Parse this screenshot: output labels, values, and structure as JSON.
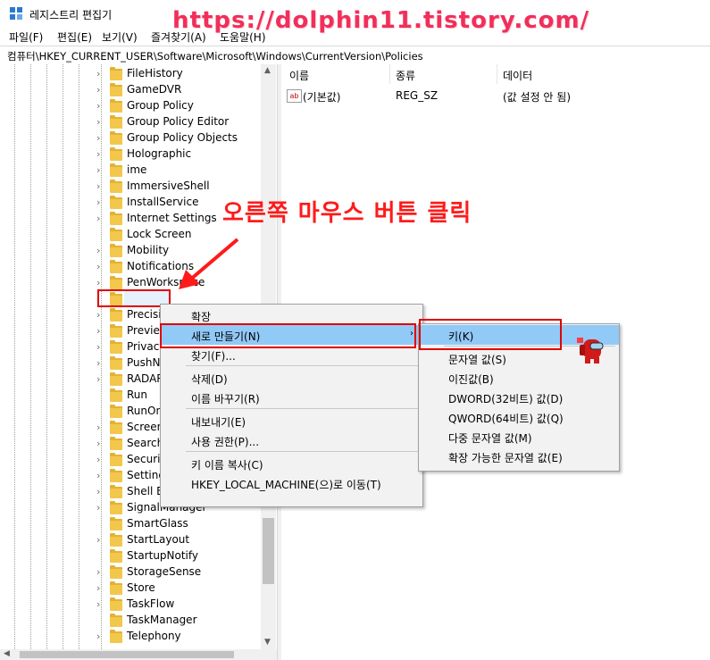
{
  "window": {
    "title": "레지스트리 편집기",
    "watermark": "https://dolphin11.tistory.com/"
  },
  "menubar": {
    "items": [
      "파일(F)",
      "편집(E)",
      "보기(V)",
      "즐겨찾기(A)",
      "도움말(H)"
    ]
  },
  "address": {
    "path": "컴퓨터\\HKEY_CURRENT_USER\\Software\\Microsoft\\Windows\\CurrentVersion\\Policies"
  },
  "tree": {
    "items": [
      {
        "label": "FileHistory",
        "expandable": true
      },
      {
        "label": "GameDVR",
        "expandable": true
      },
      {
        "label": "Group Policy",
        "expandable": true
      },
      {
        "label": "Group Policy Editor",
        "expandable": true
      },
      {
        "label": "Group Policy Objects",
        "expandable": true
      },
      {
        "label": "Holographic",
        "expandable": true
      },
      {
        "label": "ime",
        "expandable": true
      },
      {
        "label": "ImmersiveShell",
        "expandable": true
      },
      {
        "label": "InstallService",
        "expandable": true
      },
      {
        "label": "Internet Settings",
        "expandable": true
      },
      {
        "label": "Lock Screen",
        "expandable": false
      },
      {
        "label": "Mobility",
        "expandable": true
      },
      {
        "label": "Notifications",
        "expandable": true
      },
      {
        "label": "PenWorkspace",
        "expandable": true
      },
      {
        "label": "Policies",
        "expandable": false
      },
      {
        "label": "Precisio",
        "expandable": true
      },
      {
        "label": "Preview",
        "expandable": true
      },
      {
        "label": "Privacy",
        "expandable": true
      },
      {
        "label": "PushNo",
        "expandable": true
      },
      {
        "label": "RADAR",
        "expandable": true
      },
      {
        "label": "Run",
        "expandable": false
      },
      {
        "label": "RunOn",
        "expandable": false
      },
      {
        "label": "Screen",
        "expandable": true
      },
      {
        "label": "Search",
        "expandable": true
      },
      {
        "label": "Securit",
        "expandable": true
      },
      {
        "label": "Setting",
        "expandable": true
      },
      {
        "label": "Shell E",
        "expandable": true
      },
      {
        "label": "SignalManager",
        "expandable": true
      },
      {
        "label": "SmartGlass",
        "expandable": false
      },
      {
        "label": "StartLayout",
        "expandable": true
      },
      {
        "label": "StartupNotify",
        "expandable": false
      },
      {
        "label": "StorageSense",
        "expandable": true
      },
      {
        "label": "Store",
        "expandable": true
      },
      {
        "label": "TaskFlow",
        "expandable": true
      },
      {
        "label": "TaskManager",
        "expandable": false
      },
      {
        "label": "Telephony",
        "expandable": true
      }
    ]
  },
  "list": {
    "columns": [
      "이름",
      "종류",
      "데이터"
    ],
    "rows": [
      {
        "icon": "ab",
        "name": "(기본값)",
        "type": "REG_SZ",
        "data": "(값 설정 안 됨)"
      }
    ]
  },
  "annotation": {
    "text": "오른쪽 마우스 버튼 클릭"
  },
  "context_menu": {
    "items": [
      {
        "label": "확장",
        "type": "item"
      },
      {
        "label": "새로 만들기(N)",
        "type": "submenu",
        "highlighted": true
      },
      {
        "label": "찾기(F)...",
        "type": "item"
      },
      {
        "type": "separator"
      },
      {
        "label": "삭제(D)",
        "type": "item"
      },
      {
        "label": "이름 바꾸기(R)",
        "type": "item"
      },
      {
        "type": "separator"
      },
      {
        "label": "내보내기(E)",
        "type": "item"
      },
      {
        "label": "사용 권한(P)...",
        "type": "item"
      },
      {
        "type": "separator"
      },
      {
        "label": "키 이름 복사(C)",
        "type": "item"
      },
      {
        "label": "HKEY_LOCAL_MACHINE(으)로 이동(T)",
        "type": "item"
      }
    ]
  },
  "submenu": {
    "items": [
      {
        "label": "키(K)",
        "type": "item",
        "highlighted": true
      },
      {
        "type": "separator"
      },
      {
        "label": "문자열 값(S)",
        "type": "item"
      },
      {
        "label": "이진값(B)",
        "type": "item"
      },
      {
        "label": "DWORD(32비트) 값(D)",
        "type": "item"
      },
      {
        "label": "QWORD(64비트) 값(Q)",
        "type": "item"
      },
      {
        "label": "다중 문자열 값(M)",
        "type": "item"
      },
      {
        "label": "확장 가능한 문자열 값(E)",
        "type": "item"
      }
    ]
  },
  "colors": {
    "highlight": "#91c9f7",
    "annotation_red": "#ff1a1a",
    "watermark_pink": "#f02f5a",
    "folder": "#f3c74b"
  }
}
